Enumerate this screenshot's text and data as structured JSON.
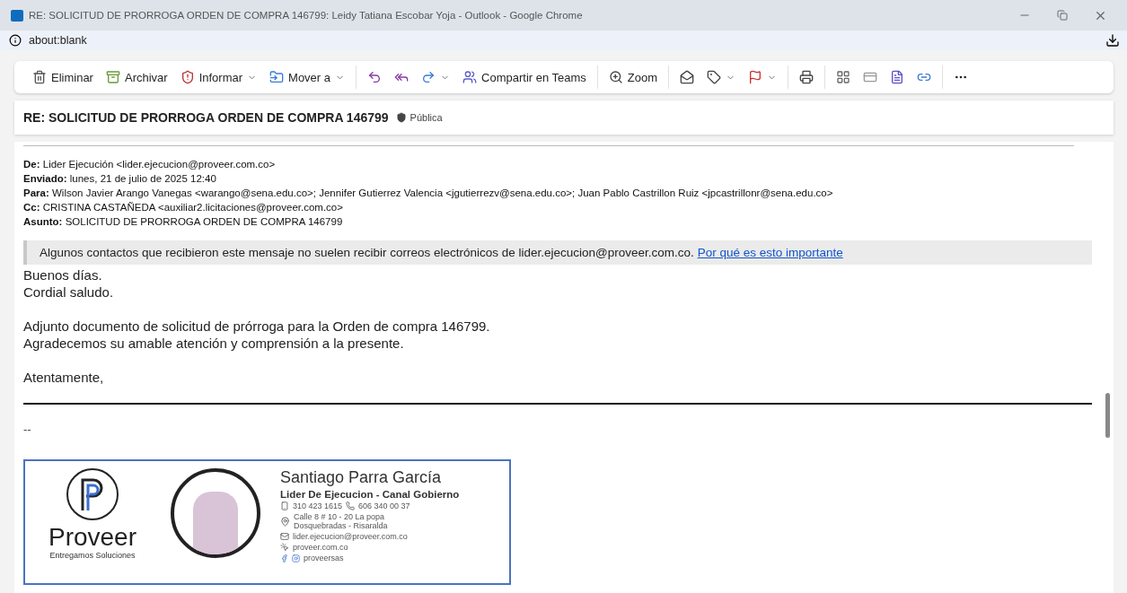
{
  "window": {
    "title": "RE: SOLICITUD DE PRORROGA ORDEN DE COMPRA 146799: Leidy Tatiana Escobar Yoja - Outlook - Google Chrome"
  },
  "address_bar": {
    "url": "about:blank"
  },
  "toolbar": {
    "groups": [
      [
        {
          "label": "Eliminar",
          "dropdown": false
        },
        {
          "label": "Archivar",
          "dropdown": false
        },
        {
          "label": "Informar",
          "dropdown": true
        },
        {
          "label": "Mover a",
          "dropdown": true
        }
      ],
      [
        {
          "dropdown": false
        },
        {
          "dropdown": false
        },
        {
          "dropdown": true
        },
        {
          "label": "Compartir en Teams",
          "dropdown": false
        }
      ],
      [
        {
          "label": "Zoom",
          "dropdown": false
        }
      ],
      [
        {
          "dropdown": false
        },
        {
          "dropdown": true
        },
        {
          "dropdown": true
        }
      ],
      [
        {
          "dropdown": false
        }
      ],
      [
        {
          "dropdown": false
        },
        {
          "dropdown": false
        },
        {
          "dropdown": false
        },
        {
          "dropdown": false
        }
      ],
      [
        {
          "dropdown": false
        }
      ]
    ]
  },
  "message": {
    "subject": "RE: SOLICITUD DE PRORROGA ORDEN DE COMPRA 146799",
    "sensitivity": "Pública",
    "headers": [
      {
        "label": "De:",
        "value": "Lider Ejecución <lider.ejecucion@proveer.com.co>"
      },
      {
        "label": "Enviado:",
        "value": "lunes, 21 de julio de 2025 12:40"
      },
      {
        "label": "Para:",
        "value": "Wilson Javier Arango Vanegas <warango@sena.edu.co>; Jennifer Gutierrez Valencia <jgutierrezv@sena.edu.co>; Juan Pablo Castrillon Ruiz <jpcastrillonr@sena.edu.co>"
      },
      {
        "label": "Cc:",
        "value": "CRISTINA CASTAÑEDA <auxiliar2.licitaciones@proveer.com.co>"
      },
      {
        "label": "Asunto:",
        "value": "SOLICITUD DE PRORROGA ORDEN DE COMPRA 146799"
      }
    ],
    "warning": {
      "text": "Algunos contactos que recibieron este mensaje no suelen recibir correos electrónicos de lider.ejecucion@proveer.com.co.",
      "link": "Por qué es esto importante"
    },
    "body": [
      [
        "Buenos días.",
        "Cordial saludo."
      ],
      [
        "Adjunto documento de solicitud de prórroga para la Orden de compra 146799.",
        "Agradecemos su amable atención y comprensión a la presente."
      ],
      [
        "Atentamente,"
      ]
    ],
    "separator": "--",
    "signature": {
      "brand": "Proveer",
      "slogan": "Entregamos Soluciones",
      "name": "Santiago Parra García",
      "role": "Lider De Ejecucion - Canal Gobierno",
      "mobile": "310 423 1615",
      "phone": "606 340 00 37",
      "address": [
        "Calle 8 # 10 - 20 La popa",
        "Dosquebradas - Risaralda"
      ],
      "email": "lider.ejecucion@proveer.com.co",
      "web": "proveer.com.co",
      "social": "proveersas"
    }
  }
}
